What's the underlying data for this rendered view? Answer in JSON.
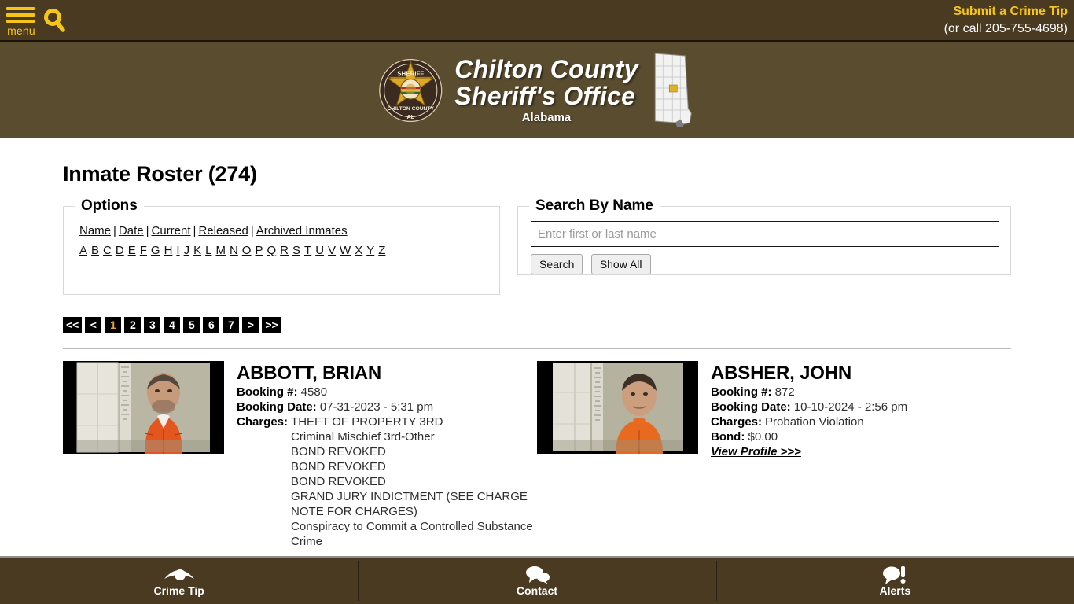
{
  "topbar": {
    "menu_label": "menu",
    "menu_icon": "hamburger-icon",
    "search_icon": "search-icon",
    "crime_tip_label": "Submit a Crime Tip",
    "crime_tip_phone": "(or call 205-755-4698)"
  },
  "brand": {
    "badge_icon": "sheriff-badge-logo",
    "line1": "Chilton County",
    "line2": "Sheriff's Office",
    "subtitle": "Alabama",
    "map_icon": "alabama-state-map-icon"
  },
  "page": {
    "title": "Inmate Roster (274)"
  },
  "options": {
    "legend": "Options",
    "links": [
      "Name",
      "Date",
      "Current",
      "Released",
      "Archived Inmates"
    ],
    "separator": "|",
    "alphabet": [
      "A",
      "B",
      "C",
      "D",
      "E",
      "F",
      "G",
      "H",
      "I",
      "J",
      "K",
      "L",
      "M",
      "N",
      "O",
      "P",
      "Q",
      "R",
      "S",
      "T",
      "U",
      "V",
      "W",
      "X",
      "Y",
      "Z"
    ]
  },
  "search": {
    "legend": "Search By Name",
    "placeholder": "Enter first or last name",
    "value": "",
    "search_button": "Search",
    "show_all_button": "Show All"
  },
  "pagination": {
    "items": [
      {
        "label": "<<",
        "active": false
      },
      {
        "label": "<",
        "active": false
      },
      {
        "label": "1",
        "active": true
      },
      {
        "label": "2",
        "active": false
      },
      {
        "label": "3",
        "active": false
      },
      {
        "label": "4",
        "active": false
      },
      {
        "label": "5",
        "active": false
      },
      {
        "label": "6",
        "active": false
      },
      {
        "label": "7",
        "active": false
      },
      {
        "label": ">",
        "active": false
      },
      {
        "label": ">>",
        "active": false
      }
    ],
    "active_color": "#f0a51e"
  },
  "labels": {
    "booking_no": "Booking #:",
    "booking_date": "Booking Date:",
    "charges": "Charges:",
    "bond": "Bond:",
    "view_profile": "View Profile >>>"
  },
  "inmates": [
    {
      "name": "ABBOTT, BRIAN",
      "mugshot": "inmate-mugshot-abbott-brian",
      "booking_no": "4580",
      "booking_date": "07-31-2023 - 5:31 pm",
      "charges": [
        "THEFT OF PROPERTY 3RD",
        "Criminal Mischief 3rd-Other",
        "BOND REVOKED",
        "BOND REVOKED",
        "BOND REVOKED",
        "GRAND JURY INDICTMENT (SEE CHARGE NOTE FOR CHARGES)",
        "Conspiracy to Commit a Controlled Substance Crime"
      ],
      "bond": null,
      "view_profile": null
    },
    {
      "name": "ABSHER, JOHN",
      "mugshot": "inmate-mugshot-absher-john",
      "booking_no": "872",
      "booking_date": "10-10-2024 - 2:56 pm",
      "charges": [
        "Probation Violation"
      ],
      "bond": "$0.00",
      "view_profile": "View Profile >>>"
    }
  ],
  "bottom_nav": [
    {
      "label": "Crime Tip",
      "icon": "eye-icon"
    },
    {
      "label": "Contact",
      "icon": "chat-bubbles-icon"
    },
    {
      "label": "Alerts",
      "icon": "alert-bubble-icon"
    }
  ],
  "colors": {
    "header_brown": "#493a21",
    "brand_brown": "#5a4c2f",
    "accent_gold": "#f5c518",
    "active_page": "#f0a51e"
  }
}
